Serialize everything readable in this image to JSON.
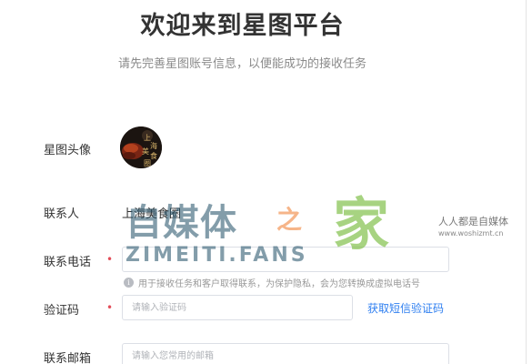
{
  "header": {
    "title": "欢迎来到星图平台",
    "subtitle": "请先完善星图账号信息，以便能成功的接收任务"
  },
  "form": {
    "avatar": {
      "label": "星图头像",
      "image_text": "上海美食圈"
    },
    "contact_person": {
      "label": "联系人",
      "value": "上海美食圈"
    },
    "phone": {
      "label": "联系电话",
      "required_mark": "•",
      "value": "",
      "placeholder": "",
      "hint_icon": "info-icon",
      "hint": "用于接收任务和客户取得联系，为保护隐私，会为您转换成虚拟电话号"
    },
    "code": {
      "label": "验证码",
      "required_mark": "•",
      "value": "",
      "placeholder": "请输入验证码",
      "sms_link": "获取短信验证码"
    },
    "email": {
      "label": "联系邮箱",
      "value": "",
      "placeholder": "请输入您常用的邮箱"
    }
  },
  "watermark": {
    "main": "自媒体",
    "zhi": "之",
    "jia": "家",
    "fans": "ZIMEITI.FANS",
    "slogan": "人人都是自媒体",
    "url": "www.woshizmt.cn"
  },
  "colors": {
    "accent": "#2f7ff0",
    "required": "#e34d59",
    "watermark_blue": "#1f4e66",
    "watermark_orange": "#f07a2a",
    "watermark_green": "#79bd3e"
  }
}
